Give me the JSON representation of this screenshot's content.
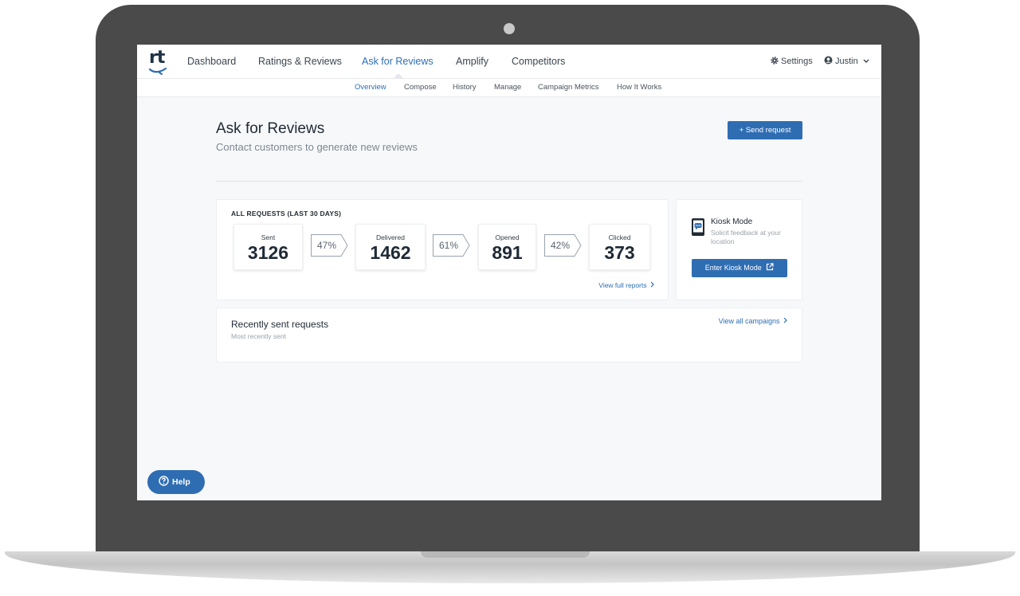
{
  "brand": {
    "logo_text": "rt",
    "accent": "#2f6db3"
  },
  "nav": {
    "items": [
      {
        "label": "Dashboard"
      },
      {
        "label": "Ratings & Reviews"
      },
      {
        "label": "Ask for Reviews"
      },
      {
        "label": "Amplify"
      },
      {
        "label": "Competitors"
      }
    ],
    "active": "Ask for Reviews",
    "settings_label": "Settings",
    "settings_icon": "gear-icon",
    "user_label": "Justin",
    "user_icon": "user-circle-icon"
  },
  "subnav": {
    "items": [
      {
        "label": "Overview"
      },
      {
        "label": "Compose"
      },
      {
        "label": "History"
      },
      {
        "label": "Manage"
      },
      {
        "label": "Campaign Metrics"
      },
      {
        "label": "How It Works"
      }
    ],
    "active": "Overview"
  },
  "page": {
    "title": "Ask for Reviews",
    "subtitle": "Contact customers to generate new reviews",
    "send_button": "+ Send request"
  },
  "stats": {
    "heading": "ALL REQUESTS (LAST 30 DAYS)",
    "boxes": [
      {
        "label": "Sent",
        "value": "3126"
      },
      {
        "label": "Delivered",
        "value": "1462"
      },
      {
        "label": "Opened",
        "value": "891"
      },
      {
        "label": "Clicked",
        "value": "373"
      }
    ],
    "rates": [
      "47%",
      "61%",
      "42%"
    ],
    "view_reports": "View full reports"
  },
  "kiosk": {
    "title": "Kiosk Mode",
    "description": "Solicit feedback at your location",
    "button": "Enter Kiosk Mode",
    "icon": "tablet-chat-icon"
  },
  "recent": {
    "title": "Recently sent requests",
    "subtitle": "Most recently sent",
    "view_all": "View all campaigns"
  },
  "help": {
    "label": "Help",
    "icon": "question-circle-icon"
  }
}
